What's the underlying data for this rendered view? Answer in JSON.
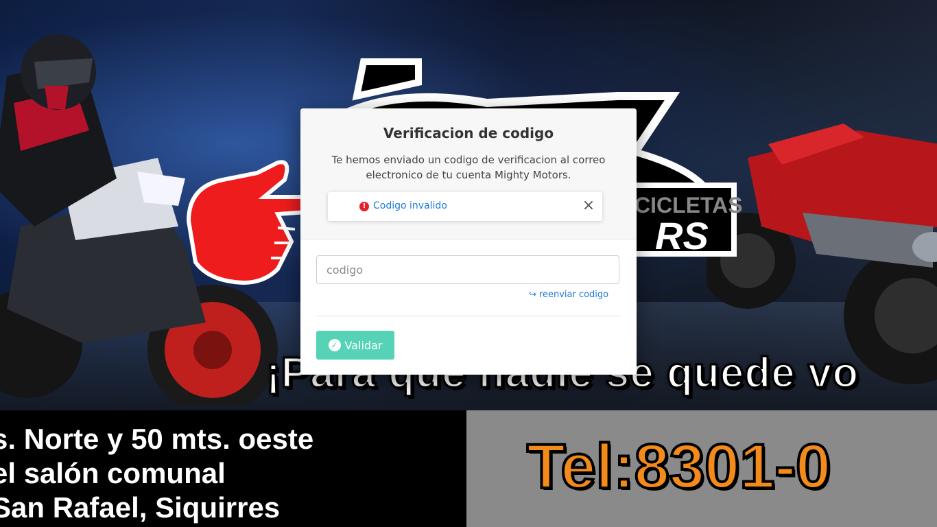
{
  "background": {
    "slogan": "¡Para que nadie se quede vo",
    "logo_text_top": "CICLETAS",
    "logo_text_bottom": "RS",
    "address_lines": [
      "s. Norte y 50 mts. oeste",
      "el salón comunal",
      "San Rafael, Siquirres"
    ],
    "phone": "Tel:8301-0"
  },
  "modal": {
    "title": "Verificacion de codigo",
    "description": "Te hemos enviado un codigo de verificacion al correo electronico de tu cuenta Mighty Motors.",
    "alert": {
      "icon": "exclamation-circle-icon",
      "text": "Codigo invalido",
      "close": "×"
    },
    "code_input": {
      "placeholder": "codigo",
      "value": ""
    },
    "resend_icon": "share-icon",
    "resend_label": "reenviar codigo",
    "validate_label": "Validar"
  },
  "colors": {
    "accent_teal": "#56d3b6",
    "link_blue": "#1e7ad6",
    "error_red": "#e4202a",
    "phone_orange": "#f28a1c",
    "pointer_red": "#ee1c1c"
  }
}
